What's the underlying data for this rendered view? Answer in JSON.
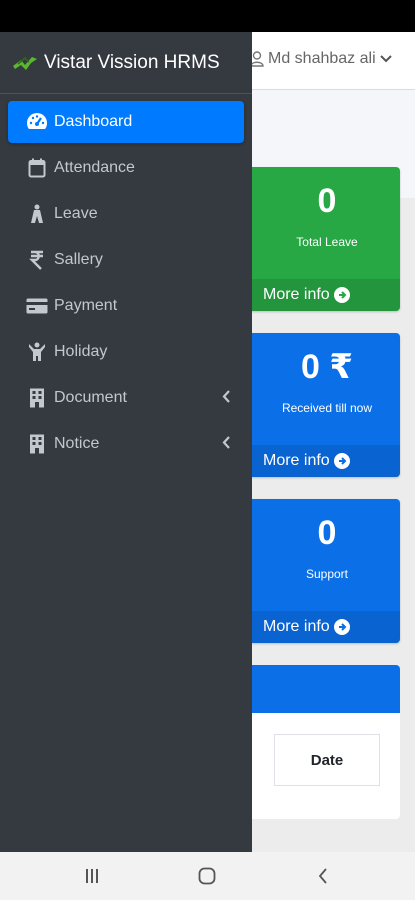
{
  "header": {
    "user_name": "Md shahbaz ali"
  },
  "sidebar": {
    "brand": "Vistar Vission HRMS",
    "items": [
      {
        "label": "Dashboard",
        "icon": "tachometer-icon",
        "active": true
      },
      {
        "label": "Attendance",
        "icon": "calendar-icon"
      },
      {
        "label": "Leave",
        "icon": "road-icon"
      },
      {
        "label": "Sallery",
        "icon": "rupee-icon"
      },
      {
        "label": "Payment",
        "icon": "credit-card-icon"
      },
      {
        "label": "Holiday",
        "icon": "holiday-person-icon"
      },
      {
        "label": "Document",
        "icon": "building-icon",
        "has_submenu": true
      },
      {
        "label": "Notice",
        "icon": "building-icon",
        "has_submenu": true
      }
    ]
  },
  "boxes": [
    {
      "value": "0",
      "label": "Total Leave",
      "footer": "More info",
      "color": "#28a745"
    },
    {
      "value": "0 ₹",
      "label": "Received till now",
      "footer": "More info",
      "color": "#0b6fe8"
    },
    {
      "value": "0",
      "label": "Support",
      "footer": "More info",
      "color": "#0b6fe8"
    }
  ],
  "table": {
    "header_date": "Date"
  },
  "colors": {
    "sidebar_bg": "#343a40",
    "active": "#007bff"
  }
}
